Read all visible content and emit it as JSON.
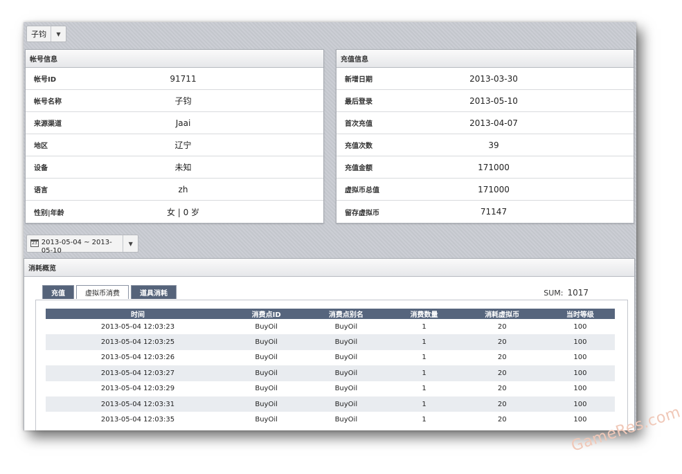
{
  "account_select": {
    "value": "子钧"
  },
  "account_info": {
    "title": "帐号信息",
    "rows": [
      {
        "label": "帐号ID",
        "value": "91711"
      },
      {
        "label": "帐号名称",
        "value": "子钧"
      },
      {
        "label": "来源渠道",
        "value": "Jaai"
      },
      {
        "label": "地区",
        "value": "辽宁"
      },
      {
        "label": "设备",
        "value": "未知"
      },
      {
        "label": "语言",
        "value": "zh"
      },
      {
        "label": "性别|年龄",
        "value": "女 | 0 岁"
      }
    ]
  },
  "recharge_info": {
    "title": "充值信息",
    "rows": [
      {
        "label": "新增日期",
        "value": "2013-03-30"
      },
      {
        "label": "最后登录",
        "value": "2013-05-10"
      },
      {
        "label": "首次充值",
        "value": "2013-04-07"
      },
      {
        "label": "充值次数",
        "value": "39"
      },
      {
        "label": "充值金额",
        "value": "171000"
      },
      {
        "label": "虚拟币总值",
        "value": "171000"
      },
      {
        "label": "留存虚拟币",
        "value": "71147"
      }
    ]
  },
  "date_range": {
    "value": "2013-05-04 ~ 2013-05-10"
  },
  "consume": {
    "title": "消耗概览",
    "tabs": [
      {
        "label": "充值",
        "active": false
      },
      {
        "label": "虚拟币消费",
        "active": true
      },
      {
        "label": "道具消耗",
        "active": false
      }
    ],
    "sum_label": "SUM:",
    "sum_value": "1017",
    "table": {
      "headers": [
        "时间",
        "消费点ID",
        "消费点别名",
        "消费数量",
        "消耗虚拟币",
        "当时等级"
      ],
      "rows": [
        [
          "2013-05-04 12:03:23",
          "BuyOil",
          "BuyOil",
          "1",
          "20",
          "100"
        ],
        [
          "2013-05-04 12:03:25",
          "BuyOil",
          "BuyOil",
          "1",
          "20",
          "100"
        ],
        [
          "2013-05-04 12:03:26",
          "BuyOil",
          "BuyOil",
          "1",
          "20",
          "100"
        ],
        [
          "2013-05-04 12:03:27",
          "BuyOil",
          "BuyOil",
          "1",
          "20",
          "100"
        ],
        [
          "2013-05-04 12:03:29",
          "BuyOil",
          "BuyOil",
          "1",
          "20",
          "100"
        ],
        [
          "2013-05-04 12:03:31",
          "BuyOil",
          "BuyOil",
          "1",
          "20",
          "100"
        ],
        [
          "2013-05-04 12:03:35",
          "BuyOil",
          "BuyOil",
          "1",
          "20",
          "100"
        ]
      ]
    }
  },
  "icons": {
    "dropdown": "chevron-down-icon",
    "calendar": "calendar-icon"
  },
  "colors": {
    "table_header": "#56657d",
    "tab_inactive": "#55637a",
    "panel_bg": "#c9ccd3"
  },
  "watermark": "GameRes.com"
}
